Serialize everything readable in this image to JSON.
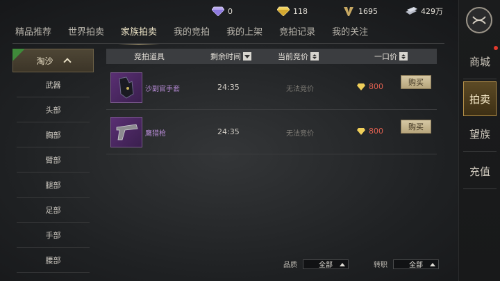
{
  "currencies": [
    {
      "icon": "diamond-icon",
      "value": "0"
    },
    {
      "icon": "gold-diamond-icon",
      "value": "118"
    },
    {
      "icon": "v-badge-icon",
      "value": "1695"
    },
    {
      "icon": "silver-bars-icon",
      "value": "429万"
    }
  ],
  "tabs": [
    {
      "label": "精品推荐"
    },
    {
      "label": "世界拍卖"
    },
    {
      "label": "家族拍卖"
    },
    {
      "label": "我的竞拍"
    },
    {
      "label": "我的上架"
    },
    {
      "label": "竞拍记录"
    },
    {
      "label": "我的关注"
    }
  ],
  "sidebar": {
    "head": "淘沙",
    "items": [
      "武器",
      "头部",
      "胸部",
      "臂部",
      "腿部",
      "足部",
      "手部",
      "腰部"
    ]
  },
  "table": {
    "headers": {
      "item": "竞拍道具",
      "time": "剩余时间",
      "bid": "当前竞价",
      "price": "一口价"
    },
    "rows": [
      {
        "name": "沙副官手套",
        "time": "24:35",
        "bid": "无法竞价",
        "price": "800",
        "buy": "购买",
        "icon": "gloves-icon"
      },
      {
        "name": "鹰猎枪",
        "time": "24:35",
        "bid": "无法竞价",
        "price": "800",
        "buy": "购买",
        "icon": "pistol-icon"
      }
    ]
  },
  "filters": {
    "quality_label": "品质",
    "quality_value": "全部",
    "class_label": "转职",
    "class_value": "全部"
  },
  "rightnav": [
    {
      "label": "商城"
    },
    {
      "label": "拍卖"
    },
    {
      "label": "望族"
    },
    {
      "label": "充值"
    }
  ],
  "colors": {
    "accent": "#d7c28c",
    "price": "#e06050",
    "item_name": "#b58ad4"
  }
}
